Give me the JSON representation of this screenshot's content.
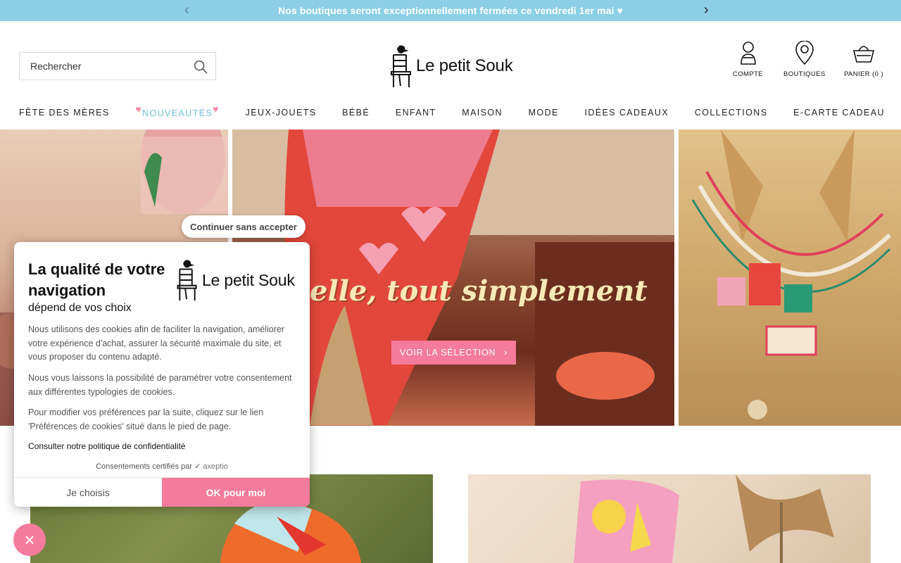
{
  "announcement": {
    "text": "Nos boutiques seront exceptionnellement fermées ce vendredi 1er mai ♥",
    "prev_icon": "‹",
    "next_icon": "›"
  },
  "header": {
    "search_placeholder": "Rechercher",
    "logo_text": "Le petit Souk",
    "actions": {
      "account": "COMPTE",
      "stores": "BOUTIQUES",
      "cart": "PANIER (0 )"
    }
  },
  "nav": {
    "items": [
      "FÊTE DES MÈRES",
      "NOUVEAUTÉS",
      "JEUX-JOUETS",
      "BÉBÉ",
      "ENFANT",
      "MAISON",
      "MODE",
      "IDÉES CADEAUX",
      "COLLECTIONS",
      "E-CARTE CADEAU"
    ],
    "heart": "♥"
  },
  "hero": {
    "title": "elle, tout simplement",
    "button_label": "VOIR LA SÉLECTION",
    "button_chevron": "›"
  },
  "cookie": {
    "continue_label": "Continuer sans accepter",
    "title": "La qualité de votre navigation",
    "subtitle": "dépend de vos choix",
    "logo_text": "Le petit Souk",
    "paragraphs": [
      "Nous utilisons des cookies afin de faciliter la navigation, améliorer votre expérience d'achat, assurer la sécurité maximale du site, et vous proposer du contenu adapté.",
      "Nous vous laissons la possibilité de paramétrer votre consentement aux différentes typologies de cookies.",
      "Pour modifier vos préférences par la suite, cliquez sur le lien 'Préférences de cookies' situé dans le pied de page."
    ],
    "policy_link": "Consulter notre politique de confidentialité",
    "certified_label": "Consentements certifiés par",
    "certified_brand": "axeptio",
    "choose_label": "Je choisis",
    "ok_label": "OK pour moi",
    "close_icon": "×"
  },
  "colors": {
    "announcement_bg": "#8ccfe6",
    "accent_pink": "#f47b9b",
    "nav_new": "#6fbfd8"
  }
}
